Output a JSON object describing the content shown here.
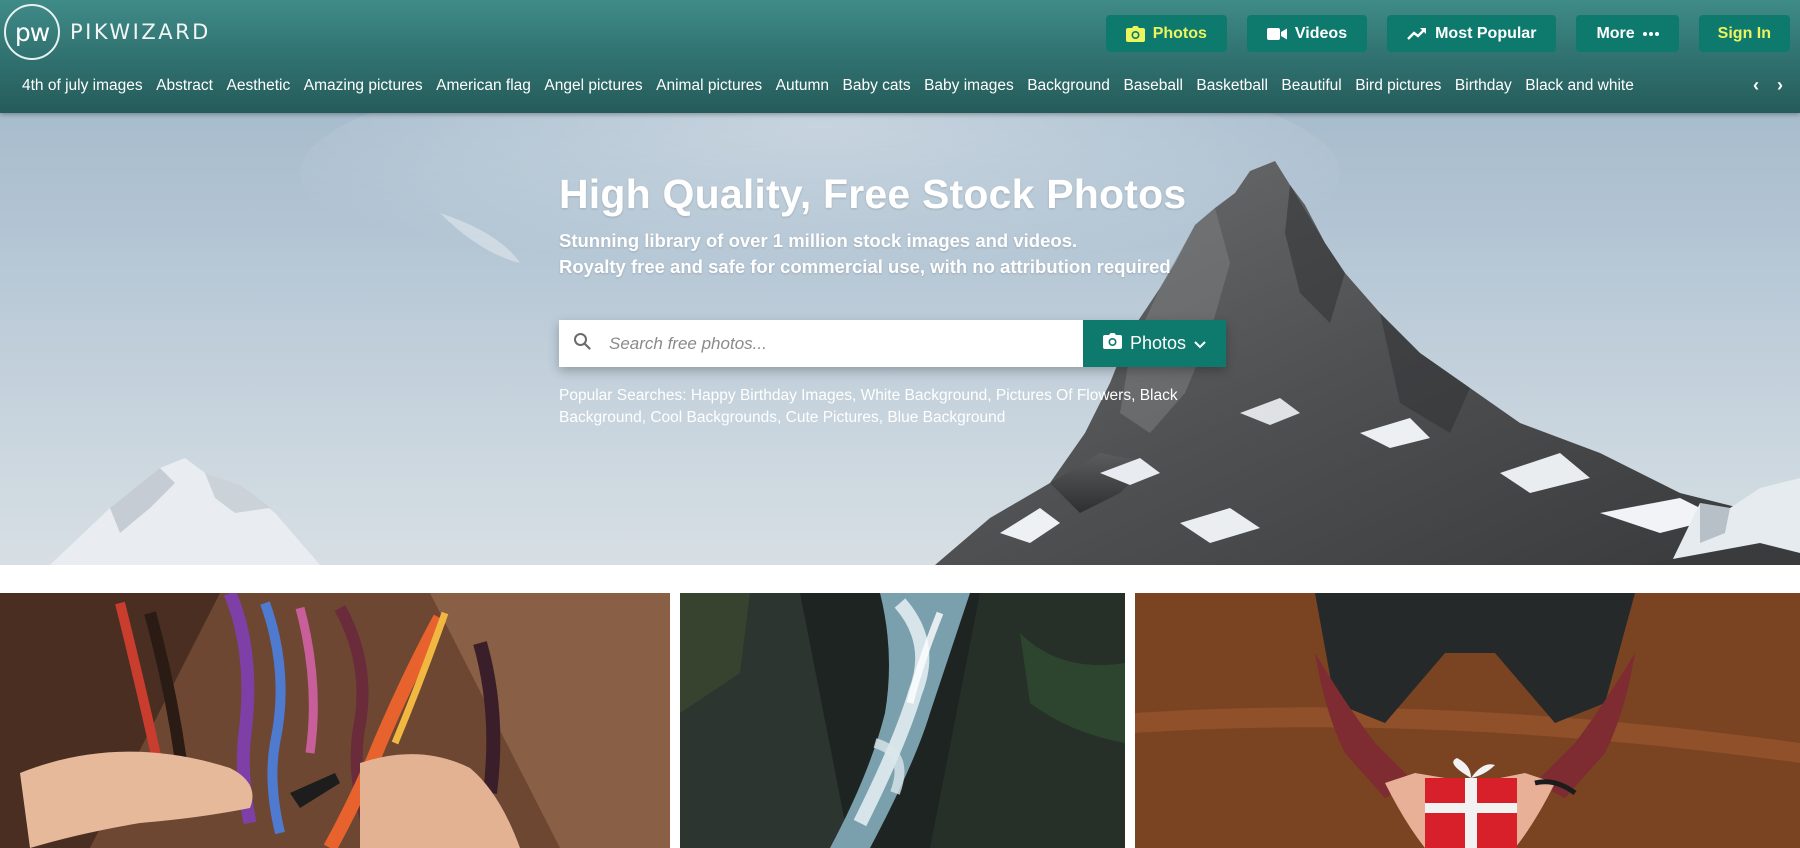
{
  "brand": {
    "mark": "pw",
    "name": "PIKWIZARD"
  },
  "topnav": [
    {
      "label": "Photos",
      "icon": "camera-icon",
      "active": true
    },
    {
      "label": "Videos",
      "icon": "video-icon",
      "active": false
    },
    {
      "label": "Most Popular",
      "icon": "trending-icon",
      "active": false
    },
    {
      "label": "More",
      "icon": "ellipsis-icon",
      "active": false
    },
    {
      "label": "Sign In",
      "active": false
    }
  ],
  "categories": [
    "4th of july images",
    "Abstract",
    "Aesthetic",
    "Amazing pictures",
    "American flag",
    "Angel pictures",
    "Animal pictures",
    "Autumn",
    "Baby cats",
    "Baby images",
    "Background",
    "Baseball",
    "Basketball",
    "Beautiful",
    "Bird pictures",
    "Birthday",
    "Black and white"
  ],
  "category_arrows": {
    "prev": "‹",
    "next": "›"
  },
  "hero": {
    "title": "High Quality, Free Stock Photos",
    "subtitle_line1": "Stunning library of over 1 million stock images and videos.",
    "subtitle_line2": "Royalty free and safe for commercial use, with no attribution required",
    "search": {
      "placeholder": "Search free photos...",
      "type_label": "Photos"
    },
    "popular_label": "Popular Searches:",
    "popular_searches": [
      "Happy Birthday Images",
      "White Background",
      "Pictures Of Flowers",
      "Black Background",
      "Cool Backgrounds",
      "Cute Pictures",
      "Blue Background"
    ]
  },
  "colors": {
    "header": "#2f706e",
    "button": "#0e7a6d",
    "active_text": "#ecf55e"
  },
  "gallery": [
    {
      "subject": "hands braiding colorful threads"
    },
    {
      "subject": "waterfall in a rocky gorge"
    },
    {
      "subject": "hands holding a red gift box"
    }
  ]
}
